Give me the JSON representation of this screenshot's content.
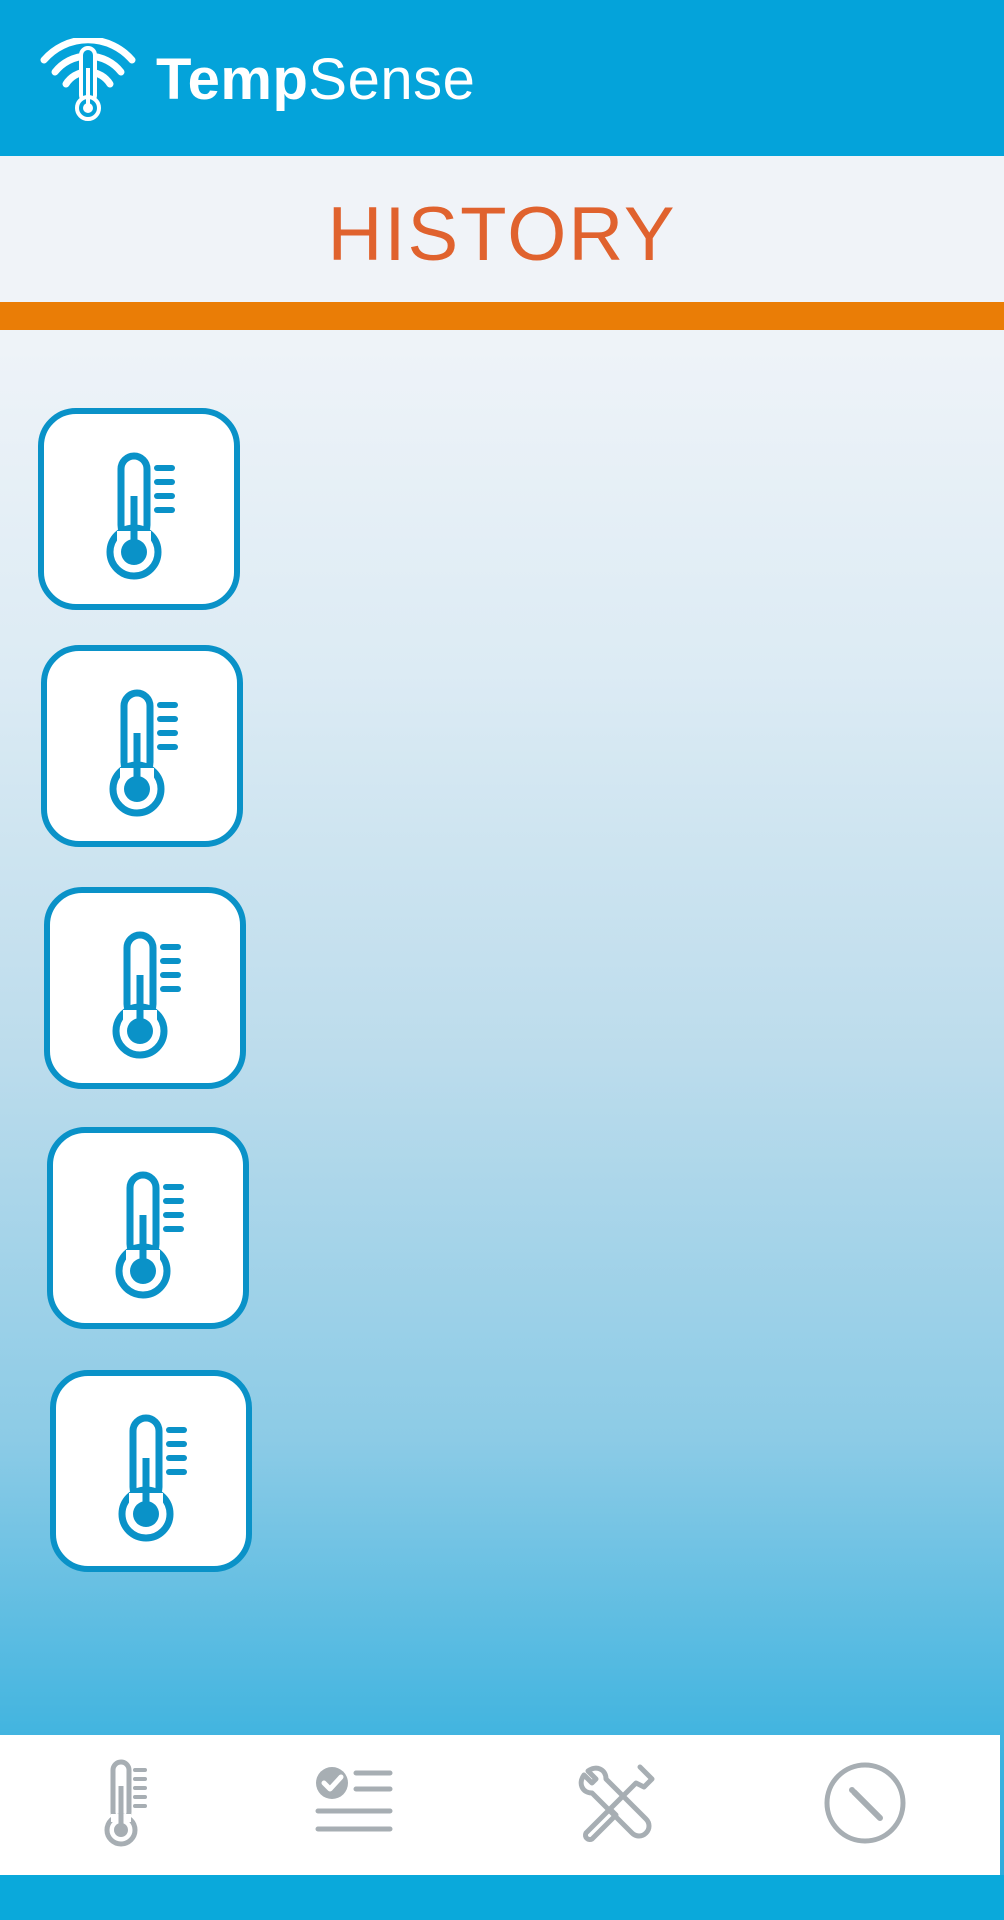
{
  "app": {
    "brand_bold": "Temp",
    "brand_light": "Sense",
    "logo_icon": "wifi-thermometer-icon"
  },
  "page": {
    "title": "HISTORY"
  },
  "history": {
    "items": [
      {
        "icon": "thermometer-icon"
      },
      {
        "icon": "thermometer-icon"
      },
      {
        "icon": "thermometer-icon"
      },
      {
        "icon": "thermometer-icon"
      },
      {
        "icon": "thermometer-icon"
      }
    ]
  },
  "nav": {
    "items": [
      {
        "icon": "thermometer-icon"
      },
      {
        "icon": "checklist-icon"
      },
      {
        "icon": "tools-icon"
      },
      {
        "icon": "compass-icon"
      }
    ]
  },
  "colors": {
    "header": "#04a3da",
    "title": "#e0622e",
    "accent_bar": "#ea7d06",
    "icon_blue": "#0a92c8",
    "nav_icon": "#a7aeb3"
  }
}
